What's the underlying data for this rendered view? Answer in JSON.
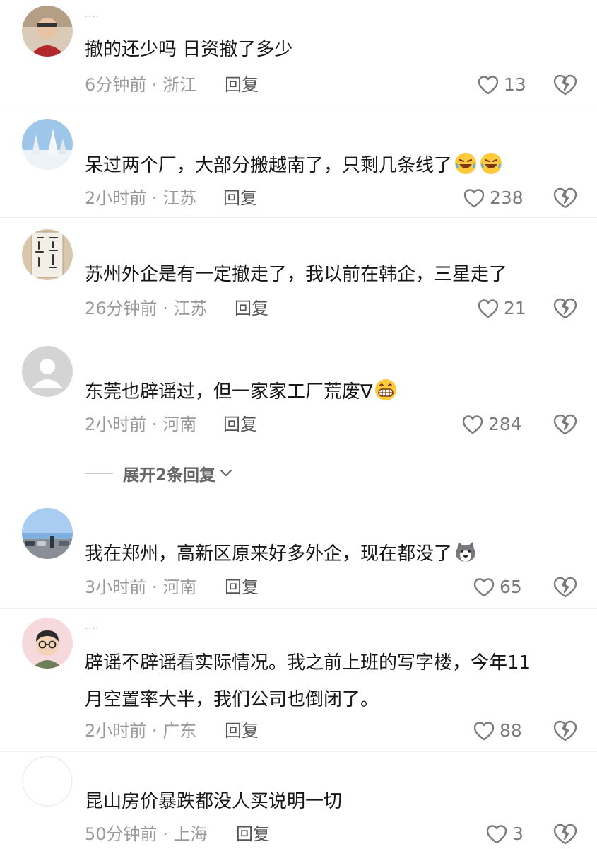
{
  "comments": [
    {
      "username": "‥‥",
      "text": "撤的还少吗 日资撤了多少",
      "time": "6分钟前",
      "location": "浙江",
      "reply_label": "回复",
      "likes": "13"
    },
    {
      "username": "",
      "text": "呆过两个厂，大部分搬越南了，只剩几条线了",
      "time": "2小时前",
      "location": "江苏",
      "reply_label": "回复",
      "likes": "238",
      "emojis": [
        "rofl-emoji",
        "rofl-emoji"
      ]
    },
    {
      "username": "",
      "text": "苏州外企是有一定撤走了，我以前在韩企，三星走了",
      "time": "26分钟前",
      "location": "江苏",
      "reply_label": "回复",
      "likes": "21"
    },
    {
      "username": "",
      "text": "东莞也辟谣过，但一家家工厂荒废∇",
      "time": "2小时前",
      "location": "河南",
      "reply_label": "回复",
      "likes": "284",
      "emojis": [
        "grin-emoji"
      ]
    },
    {
      "username": "",
      "text": "我在郑州，高新区原来好多外企，现在都没了",
      "time": "3小时前",
      "location": "河南",
      "reply_label": "回复",
      "likes": "65",
      "emojis": [
        "husky-emoji"
      ]
    },
    {
      "username": "‥‥",
      "text_line1": "辟谣不辟谣看实际情况。我之前上班的写字楼，今年11",
      "text_line2": "月空置率大半，我们公司也倒闭了。",
      "time": "2小时前",
      "location": "广东",
      "reply_label": "回复",
      "likes": "88"
    },
    {
      "username": "",
      "text": "昆山房价暴跌都没人买说明一切",
      "time": "50分钟前",
      "location": "上海",
      "reply_label": "回复",
      "likes": "3"
    }
  ],
  "expand_replies": {
    "label": "展开2条回复"
  },
  "meta_separator": "·",
  "icons": {
    "like": "heart-outline-icon",
    "dislike": "broken-heart-icon",
    "expand": "chevron-down-icon"
  },
  "colors": {
    "text": "#161616",
    "meta": "#9a9a9a",
    "reply": "#555555",
    "icon": "#7a7a7a"
  }
}
